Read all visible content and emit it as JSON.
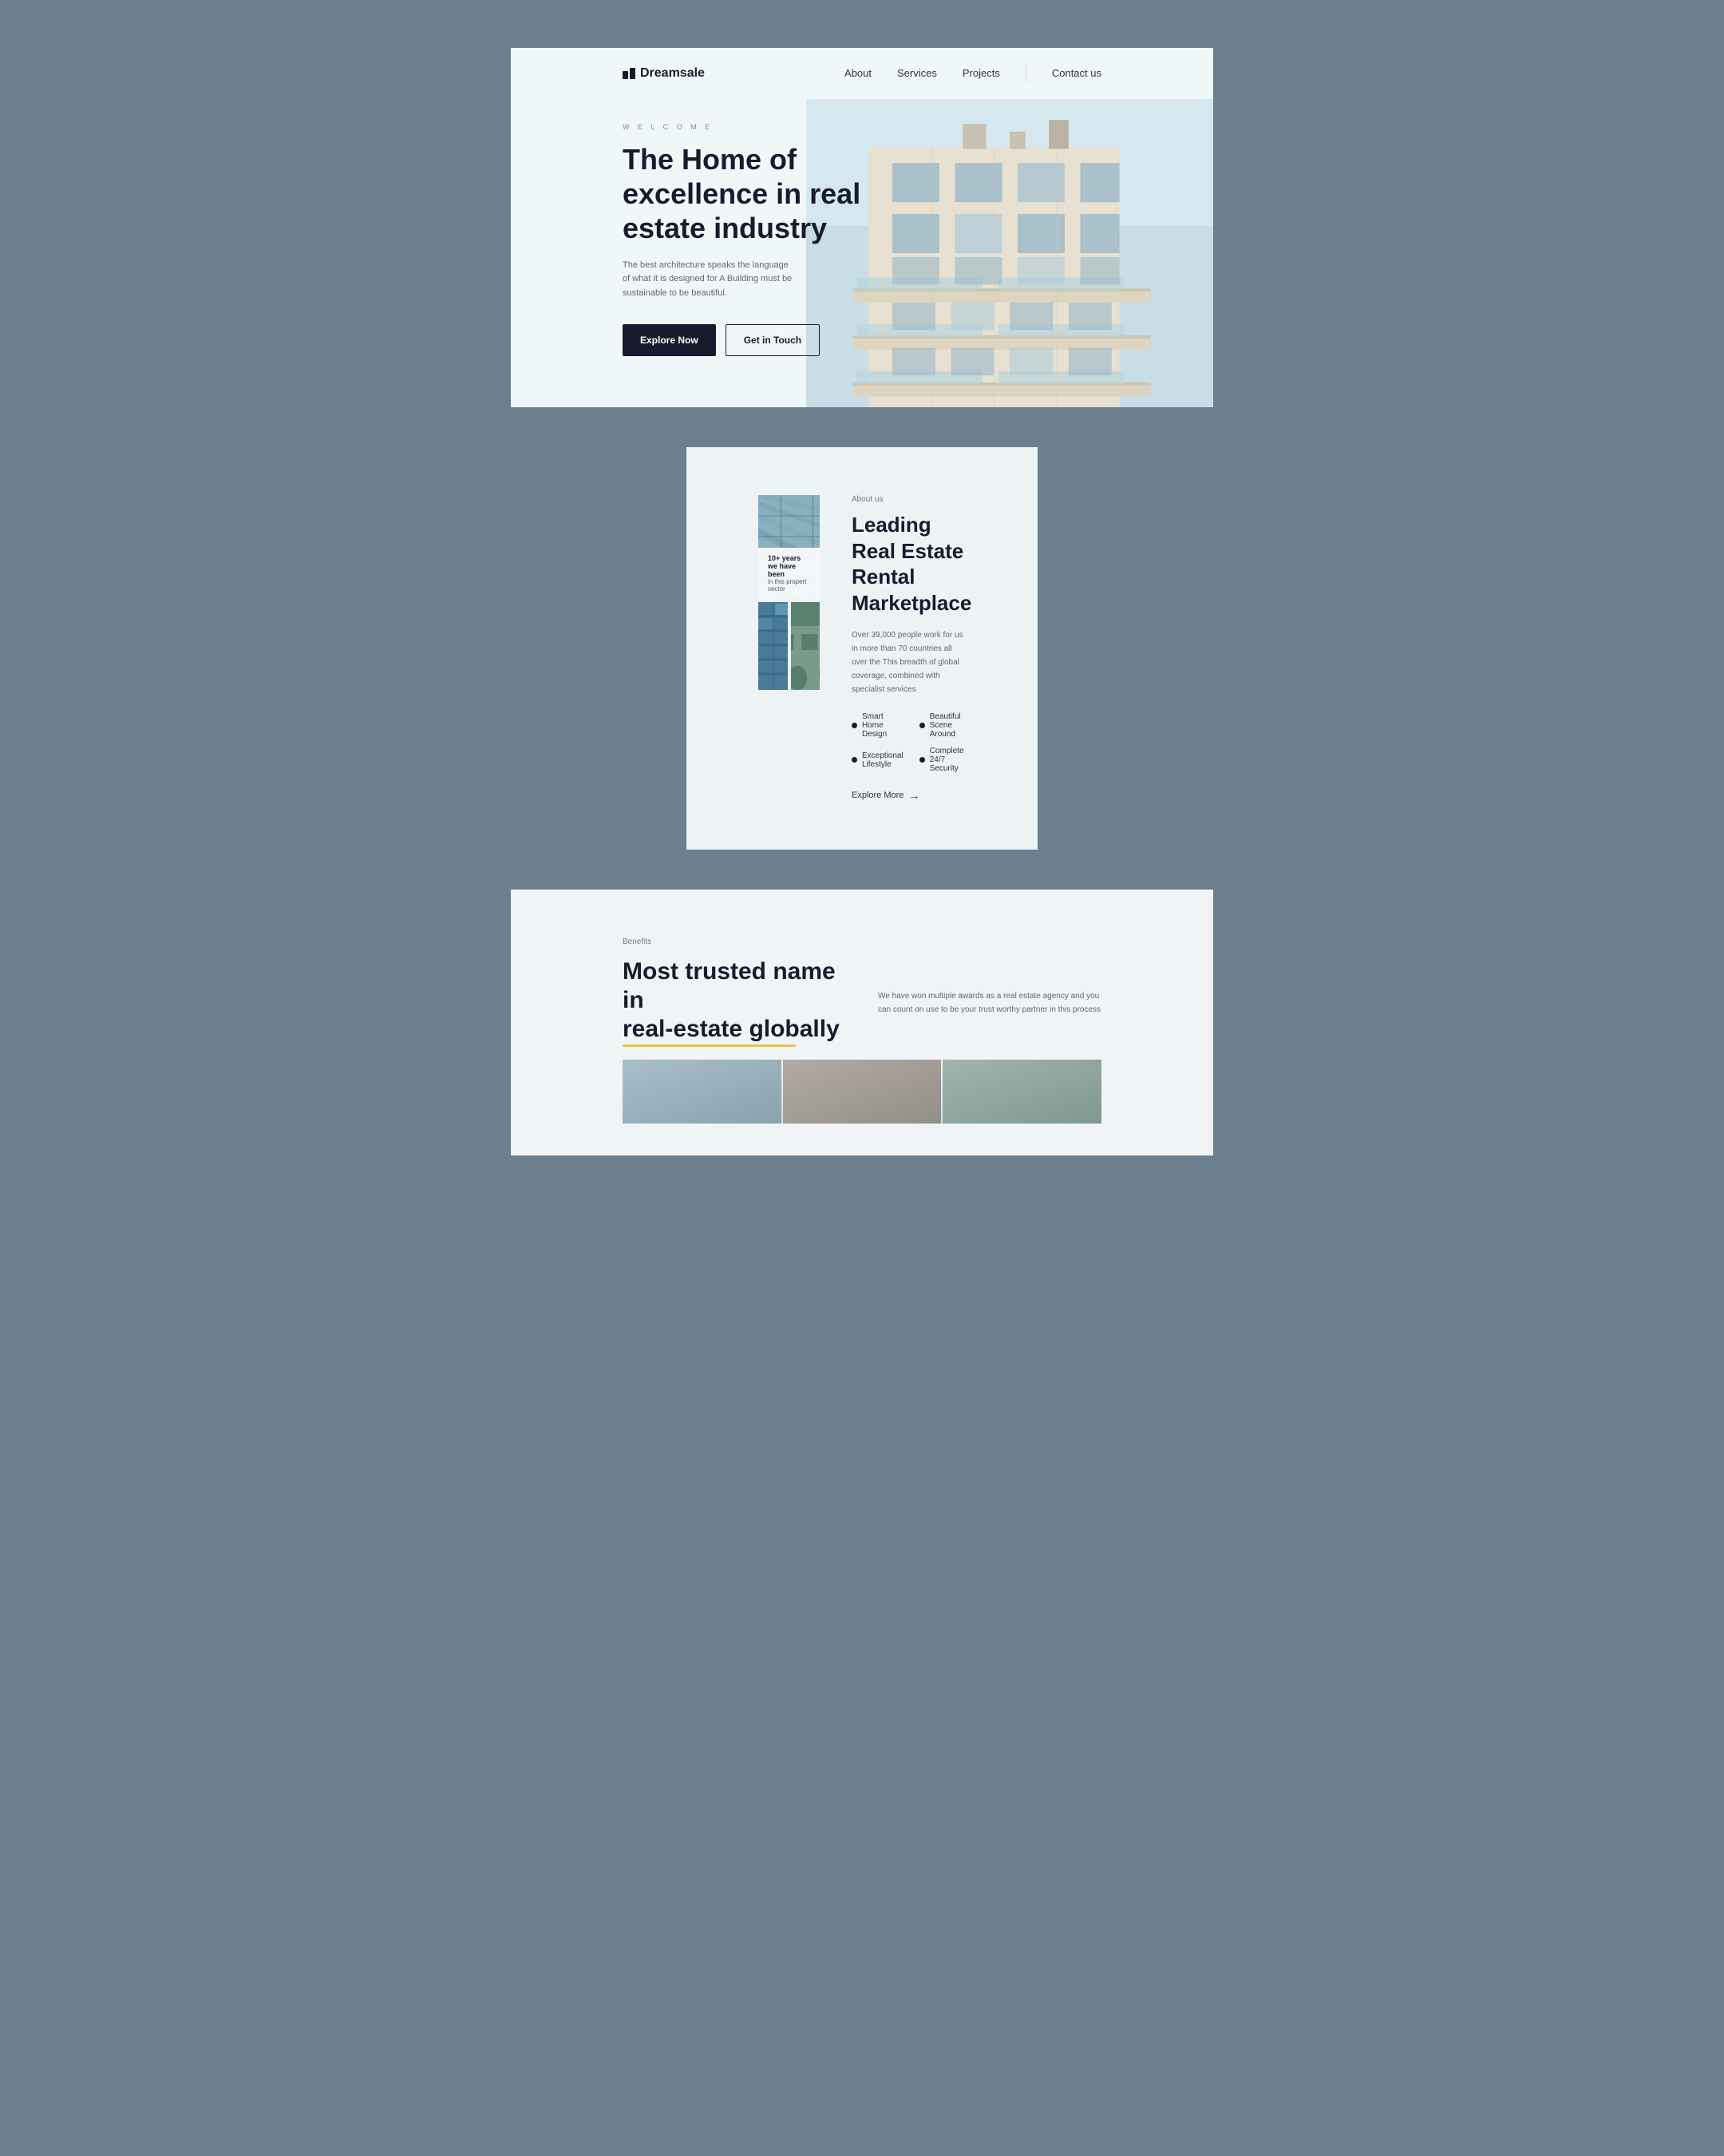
{
  "page": {
    "bg_color": "#6b7f8e"
  },
  "navbar": {
    "logo_text": "Dreamsale",
    "links": [
      {
        "label": "About",
        "href": "#"
      },
      {
        "label": "Services",
        "href": "#"
      },
      {
        "label": "Projects",
        "href": "#"
      },
      {
        "label": "Contact us",
        "href": "#"
      }
    ]
  },
  "hero": {
    "welcome_text": "W E L C O M E",
    "title_line1": "The Home of",
    "title_line2": "excellence in real",
    "title_line3": "estate industry",
    "subtitle": "The best architecture speaks the language of what it is designed for A Building must be sustainable to be beautiful.",
    "btn_explore": "Explore Now",
    "btn_contact": "Get in Touch"
  },
  "about": {
    "tag": "About us",
    "title_line1": "Leading Real Estate",
    "title_line2": "Rental Marketplace",
    "overlay_title": "10+ years we have been",
    "overlay_sub": "in this propert sector",
    "description": "Over 39,000 people work for us in more than 70 countries all over the This breadth of global coverage, combined with specialist services",
    "features": [
      "Smart Home Design",
      "Beautiful Scene Around",
      "Exceptional Lifestyle",
      "Complete 24/7 Security"
    ],
    "explore_label": "Explore More",
    "explore_arrow": "→"
  },
  "benefits": {
    "tag": "Benefits",
    "title_line1": "Most trusted name in",
    "title_line2": "real-estate globally",
    "underline_word": "globally",
    "description": "We have won multiple awards as a real estate agency and you can count on use to be your trust worthy partner in this process"
  }
}
